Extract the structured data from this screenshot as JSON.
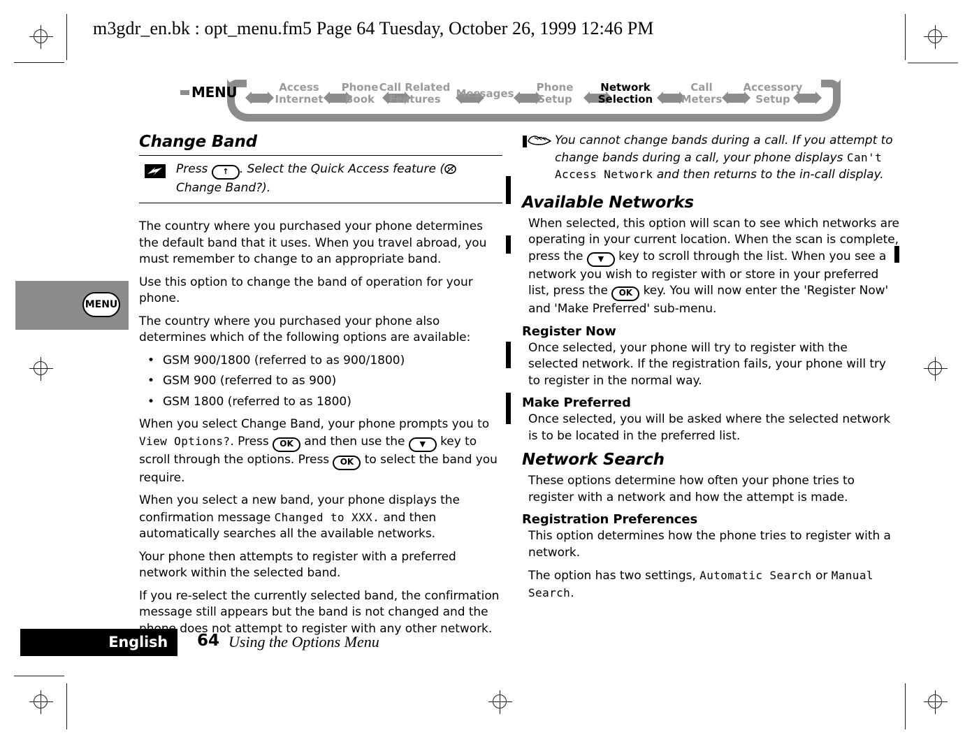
{
  "file_header": "m3gdr_en.bk : opt_menu.fm5  Page 64  Tuesday, October 26, 1999  12:46 PM",
  "colors": {
    "nav_gray": "#8c8c8c",
    "nav_label_gray": "#9a9a9a",
    "nav_label_active": "#000000",
    "tab_gray": "#8c8c8c",
    "footer_black": "#000000"
  },
  "nav": {
    "menu_label": "MENU",
    "items": [
      {
        "label_line1": "Access",
        "label_line2": "Internet",
        "active": false
      },
      {
        "label_line1": "Phone",
        "label_line2": "Book",
        "active": false
      },
      {
        "label_line1": "Call Related",
        "label_line2": "Features",
        "active": false
      },
      {
        "label_line1": "Messages",
        "label_line2": "",
        "active": false
      },
      {
        "label_line1": "Phone",
        "label_line2": "Setup",
        "active": false
      },
      {
        "label_line1": "Network",
        "label_line2": "Selection",
        "active": true
      },
      {
        "label_line1": "Call",
        "label_line2": "Meters",
        "active": false
      },
      {
        "label_line1": "Accessory",
        "label_line2": "Setup",
        "active": false
      }
    ]
  },
  "side_tab": {
    "label": "MENU"
  },
  "left_column": {
    "section_title": "Change Band",
    "quick_access": {
      "icon": "quick-access-lightning-icon",
      "text_part1": "Press ",
      "key1": "↑",
      "text_part2": ". Select the Quick Access feature (",
      "icon_inline": "change-band-glyph-icon",
      "text_part3": " Change Band?)."
    },
    "paragraphs_a": [
      "The country where you purchased your phone determines the default band that it uses. When you travel abroad, you must remember to change to an appropriate band.",
      "Use this option to change the band of operation for your phone.",
      "The country where you purchased your phone also determines which of the following options are available:"
    ],
    "bullets": [
      "GSM 900/1800 (referred to as 900/1800)",
      "GSM 900 (referred to as 900)",
      "GSM 1800 (referred to as 1800)"
    ],
    "para_select": {
      "p1": "When you select Change Band, your phone prompts you to ",
      "lcd1": "View Options?",
      "p2": ". Press ",
      "key_ok1": "OK",
      "p3": " and then use the ",
      "key_down": "▼",
      "p4": " key to scroll through the options. Press ",
      "key_ok2": "OK",
      "p5": " to select the band you require."
    },
    "para_newband": {
      "p1": "When you select a new band, your phone displays the confirmation message ",
      "lcd1": "Changed to XXX.",
      "p2": " and then automatically searches all the available networks."
    },
    "paragraphs_b": [
      "Your phone then attempts to register with a preferred network within the selected band.",
      "If you re-select the currently selected band, the confirmation message still appears but the band is not changed and the phone does not attempt to register with any other network."
    ]
  },
  "right_column": {
    "hand_note": {
      "icon": "pointing-hand-icon",
      "p1": "You cannot change bands during a call. If you attempt to change bands during a call, your phone displays ",
      "lcd1": "Can't Access Network",
      "p2": " and then returns to the in-call display."
    },
    "section_available": {
      "title": "Available Networks",
      "para": {
        "p1": "When selected, this option will scan to see which networks are operating in your current location. When the scan is complete, press the ",
        "key_down": "▼",
        "p2": " key to scroll through the list. When you see a network you wish to register with or store in your preferred list, press the ",
        "key_ok": "OK",
        "p3": " key. You will now enter the 'Register Now' and 'Make Preferred' sub-menu."
      },
      "subsections": [
        {
          "title": "Register Now",
          "body": "Once selected, your phone will try to register with the selected network. If the registration fails, your phone will try to register in the normal way."
        },
        {
          "title": "Make Preferred",
          "body": "Once selected, you will be asked where the selected network is to be located in the preferred list."
        }
      ]
    },
    "section_search": {
      "title": "Network Search",
      "intro": "These options determine how often your phone tries to register with a network and how the attempt is made.",
      "subsection": {
        "title": "Registration Preferences",
        "body1": "This option determines how the phone tries to register with a network.",
        "settings_p1": "The option has two settings, ",
        "settings_lcd1": "Automatic Search",
        "settings_p2": " or ",
        "settings_lcd2": "Manual Search",
        "settings_p3": "."
      }
    }
  },
  "footer": {
    "language": "English",
    "page_number": "64",
    "chapter": "Using the Options Menu"
  }
}
